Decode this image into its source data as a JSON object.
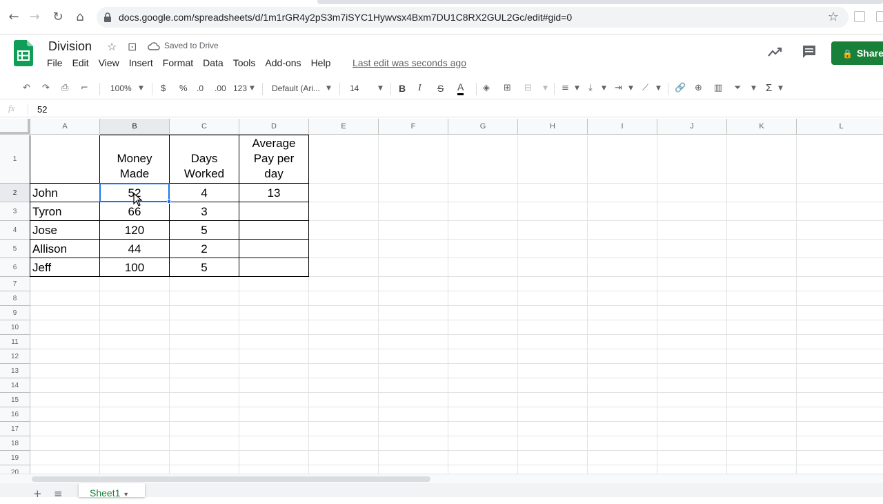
{
  "browser": {
    "url": "docs.google.com/spreadsheets/d/1m1rGR4y2pS3m7iSYC1Hywvsx4Bxm7DU1C8RX2GUL2Gc/edit#gid=0"
  },
  "header": {
    "doc_title": "Division",
    "saved_status": "Saved to Drive",
    "last_edit": "Last edit was seconds ago",
    "share_label": "Share",
    "menu": [
      "File",
      "Edit",
      "View",
      "Insert",
      "Format",
      "Data",
      "Tools",
      "Add-ons",
      "Help"
    ]
  },
  "toolbar": {
    "zoom": "100%",
    "currency": "$",
    "percent": "%",
    "decrease_decimal": ".0",
    "increase_decimal": ".00",
    "more_formats": "123",
    "font": "Default (Ari...",
    "font_size": "14",
    "bold": "B",
    "italic": "I",
    "strike": "S",
    "text_color": "A",
    "sum": "Σ"
  },
  "formula_bar": {
    "fx": "fx",
    "value": "52"
  },
  "sheet": {
    "columns": [
      "A",
      "B",
      "C",
      "D",
      "E",
      "F",
      "G",
      "H",
      "I",
      "J",
      "K",
      "L"
    ],
    "rows": [
      "1",
      "2",
      "3",
      "4",
      "5",
      "6",
      "7",
      "8",
      "9",
      "10",
      "11",
      "12",
      "13",
      "14",
      "15",
      "16",
      "17",
      "18",
      "19",
      "20"
    ],
    "header_row": {
      "b_line1": "Money",
      "b_line2": "Made",
      "c_line1": "Days",
      "c_line2": "Worked",
      "d_line1": "Average",
      "d_line2": "Pay per",
      "d_line3": "day"
    },
    "data": [
      {
        "name": "John",
        "money": "52",
        "days": "4",
        "avg": "13"
      },
      {
        "name": "Tyron",
        "money": "66",
        "days": "3",
        "avg": ""
      },
      {
        "name": "Jose",
        "money": "120",
        "days": "5",
        "avg": ""
      },
      {
        "name": "Allison",
        "money": "44",
        "days": "2",
        "avg": ""
      },
      {
        "name": "Jeff",
        "money": "100",
        "days": "5",
        "avg": ""
      }
    ],
    "selected_cell": "B2"
  },
  "sheet_tabs": {
    "active": "Sheet1"
  },
  "colors": {
    "brand_green": "#188038",
    "selection_blue": "#1a73e8"
  }
}
